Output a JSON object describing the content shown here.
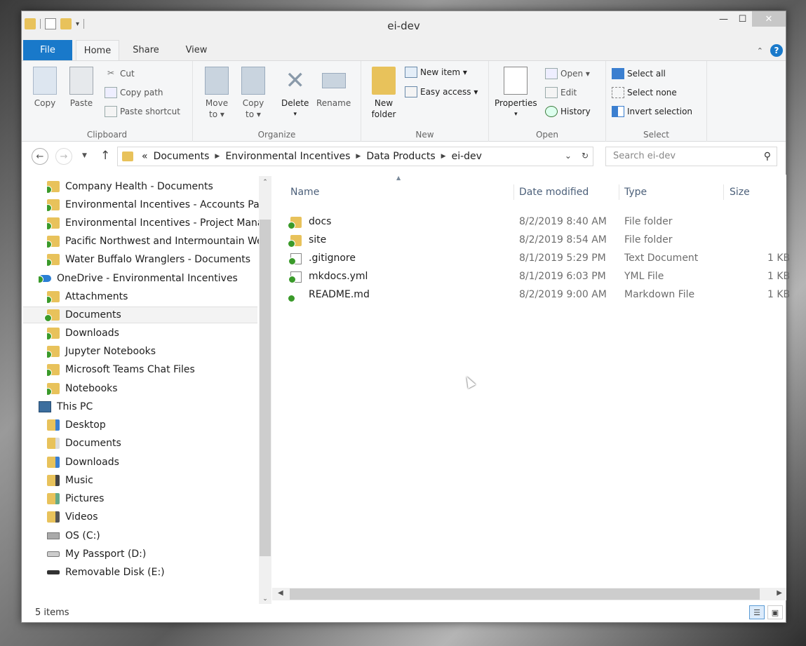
{
  "window": {
    "title": "ei-dev",
    "minimize_icon": "minimize-icon",
    "maximize_icon": "maximize-icon",
    "close_label": "✕"
  },
  "ribbon_tabs": [
    "File",
    "Home",
    "Share",
    "View"
  ],
  "ribbon": {
    "clipboard": {
      "label": "Clipboard",
      "copy": "Copy",
      "paste": "Paste",
      "cut": "Cut",
      "copy_path": "Copy path",
      "paste_shortcut": "Paste shortcut"
    },
    "organize": {
      "label": "Organize",
      "move_to": "Move to ▾",
      "copy_to": "Copy to ▾",
      "delete": "Delete",
      "rename": "Rename"
    },
    "new": {
      "label": "New",
      "new_folder": "New folder",
      "new_item": "New item ▾",
      "easy_access": "Easy access ▾"
    },
    "open": {
      "label": "Open",
      "properties": "Properties",
      "open": "Open ▾",
      "edit": "Edit",
      "history": "History"
    },
    "select": {
      "label": "Select",
      "select_all": "Select all",
      "select_none": "Select none",
      "invert_selection": "Invert selection"
    }
  },
  "address": {
    "overflow": "«",
    "crumbs": [
      "Documents",
      "Environmental Incentives",
      "Data Products",
      "ei-dev"
    ],
    "search_placeholder": "Search ei-dev"
  },
  "nav_pane": [
    {
      "label": "Company Health - Documents",
      "icon": "synced-folder-icon"
    },
    {
      "label": "Environmental Incentives - Accounts Pay",
      "icon": "synced-folder-icon"
    },
    {
      "label": "Environmental Incentives - Project Manag",
      "icon": "synced-folder-icon"
    },
    {
      "label": "Pacific Northwest and Intermountain We",
      "icon": "synced-folder-icon"
    },
    {
      "label": "Water Buffalo Wranglers - Documents",
      "icon": "synced-folder-icon"
    },
    {
      "label": "OneDrive - Environmental Incentives",
      "icon": "onedrive-icon"
    },
    {
      "label": "Attachments",
      "icon": "synced-folder-icon"
    },
    {
      "label": "Documents",
      "icon": "synced-folder-icon",
      "selected": true
    },
    {
      "label": "Downloads",
      "icon": "synced-folder-icon"
    },
    {
      "label": "Jupyter Notebooks",
      "icon": "synced-folder-icon"
    },
    {
      "label": "Microsoft Teams Chat Files",
      "icon": "synced-folder-icon"
    },
    {
      "label": "Notebooks",
      "icon": "synced-folder-icon"
    },
    {
      "label": "This PC",
      "icon": "computer-icon"
    },
    {
      "label": "Desktop",
      "icon": "desktop-folder-icon"
    },
    {
      "label": "Documents",
      "icon": "documents-folder-icon"
    },
    {
      "label": "Downloads",
      "icon": "downloads-folder-icon"
    },
    {
      "label": "Music",
      "icon": "music-folder-icon"
    },
    {
      "label": "Pictures",
      "icon": "pictures-folder-icon"
    },
    {
      "label": "Videos",
      "icon": "videos-folder-icon"
    },
    {
      "label": "OS (C:)",
      "icon": "system-drive-icon"
    },
    {
      "label": "My Passport (D:)",
      "icon": "external-drive-icon"
    },
    {
      "label": "Removable Disk (E:)",
      "icon": "removable-disk-icon"
    }
  ],
  "columns": {
    "name": "Name",
    "date": "Date modified",
    "type": "Type",
    "size": "Size"
  },
  "files": [
    {
      "name": "docs",
      "date": "8/2/2019 8:40 AM",
      "type": "File folder",
      "size": "",
      "icon": "folder-icon"
    },
    {
      "name": "site",
      "date": "8/2/2019 8:54 AM",
      "type": "File folder",
      "size": "",
      "icon": "folder-icon"
    },
    {
      "name": ".gitignore",
      "date": "8/1/2019 5:29 PM",
      "type": "Text Document",
      "size": "1 KB",
      "icon": "text-file-icon"
    },
    {
      "name": "mkdocs.yml",
      "date": "8/1/2019 6:03 PM",
      "type": "YML File",
      "size": "1 KB",
      "icon": "file-icon"
    },
    {
      "name": "README.md",
      "date": "8/2/2019 9:00 AM",
      "type": "Markdown File",
      "size": "1 KB",
      "icon": "file-icon"
    }
  ],
  "status": {
    "count": "5 items"
  },
  "colors": {
    "accent": "#1979ca",
    "folder": "#e8c25b",
    "sync_check": "#3a9a2a"
  }
}
